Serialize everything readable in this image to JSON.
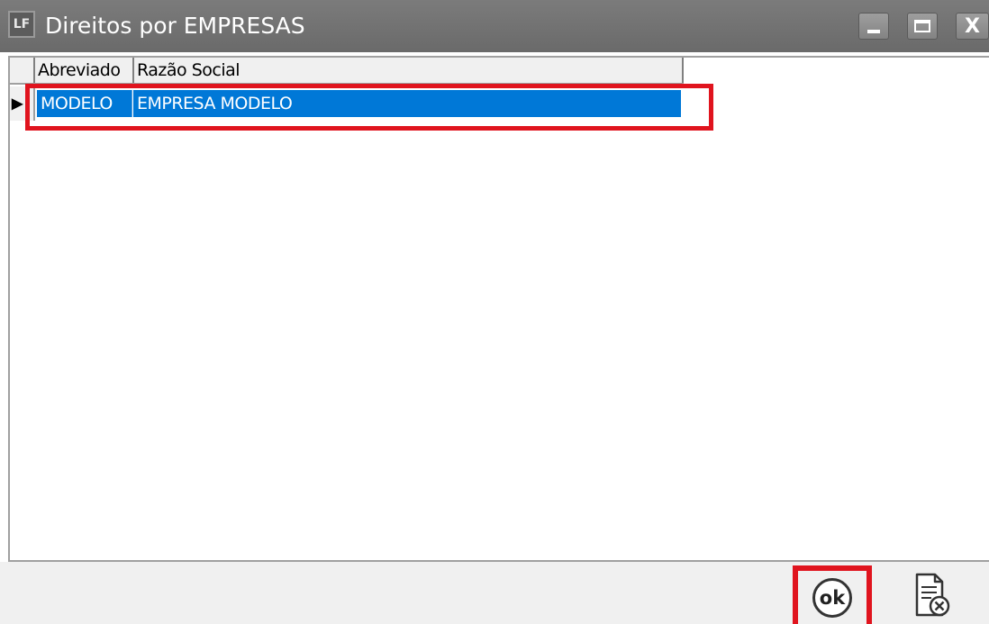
{
  "window": {
    "title": "Direitos por EMPRESAS",
    "app_icon_text": "LF",
    "close_glyph": "X"
  },
  "grid": {
    "columns": [
      "Abreviado",
      "Razão Social"
    ],
    "rows": [
      {
        "abreviado": "MODELO",
        "razao_social": "EMPRESA MODELO",
        "indicator": "▶"
      }
    ]
  },
  "buttons": {
    "ok_label": "ok"
  },
  "colors": {
    "selection": "#0078d7",
    "highlight_box": "#e0141e",
    "titlebar": "#707070"
  },
  "icons": {
    "app": "app-logo-icon",
    "ok": "ok-circle-icon",
    "cancel": "document-cancel-icon"
  }
}
